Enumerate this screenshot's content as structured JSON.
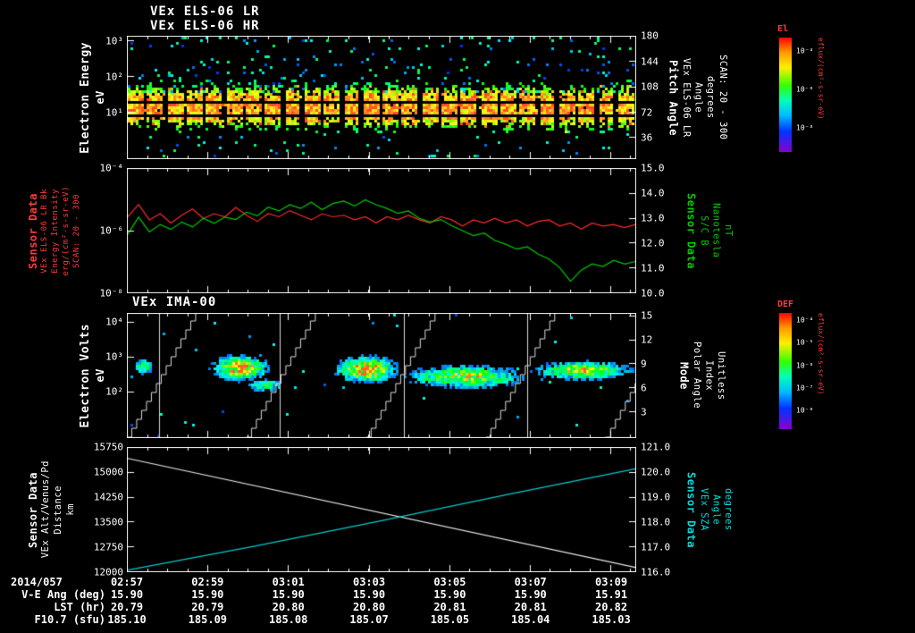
{
  "colors": {
    "background": "#000000",
    "text": "#ffffff",
    "frame": "#ffffff",
    "red_label": "#ff3b3b",
    "green_label": "#00cc00",
    "cyan_label": "#00dddd"
  },
  "panels": {
    "els": {
      "titles": [
        "VEx ELS-06 LR",
        "VEx ELS-06 HR"
      ],
      "left_label": [
        "Electron Energy",
        "eV"
      ],
      "left_ticks": [
        {
          "label": "10³",
          "frac": 0.04
        },
        {
          "label": "10²",
          "frac": 0.33
        },
        {
          "label": "10¹",
          "frac": 0.62
        }
      ],
      "right_ticks": [
        {
          "label": "180",
          "frac": 0.0
        },
        {
          "label": "144",
          "frac": 0.207
        },
        {
          "label": "108",
          "frac": 0.414
        },
        {
          "label": "72",
          "frac": 0.621
        },
        {
          "label": "36",
          "frac": 0.828
        }
      ],
      "right_label": [
        "Pitch Angle",
        "VEx ELS-06 LR",
        "Angle",
        "degrees",
        "SCAN: 20 - 300"
      ],
      "colorbar": {
        "title": "El",
        "unit": "eflux/(cm²-s-sr-eV)",
        "ticks": [
          {
            "label": "10⁻⁴",
            "frac": 0.12
          },
          {
            "label": "10⁻⁶",
            "frac": 0.45
          },
          {
            "label": "10⁻⁸",
            "frac": 0.79
          }
        ]
      }
    },
    "intensity": {
      "left_label": [
        "Sensor Data",
        "VEx ELS-06 LR Bk",
        "Energy Intensity",
        "erg/(cm²-s-sr-eV)",
        "SCAN: 20 - 300"
      ],
      "left_ticks": [
        {
          "label": "10⁻⁴",
          "frac": 0.0
        },
        {
          "label": "10⁻⁶",
          "frac": 0.5
        },
        {
          "label": "10⁻⁸",
          "frac": 1.0
        }
      ],
      "right_ticks": [
        {
          "label": "15.0",
          "frac": 0.0
        },
        {
          "label": "14.0",
          "frac": 0.2
        },
        {
          "label": "13.0",
          "frac": 0.4
        },
        {
          "label": "12.0",
          "frac": 0.6
        },
        {
          "label": "11.0",
          "frac": 0.8
        },
        {
          "label": "10.0",
          "frac": 1.0
        }
      ],
      "right_label": [
        "Sensor Data",
        "S/C B",
        "Nanotesla",
        "nT"
      ]
    },
    "ima": {
      "title": "VEx IMA-00",
      "left_label": [
        "Electron Volts",
        "eV"
      ],
      "left_ticks": [
        {
          "label": "10⁴",
          "frac": 0.07
        },
        {
          "label": "10³",
          "frac": 0.35
        },
        {
          "label": "10²",
          "frac": 0.63
        }
      ],
      "right_ticks": [
        {
          "label": "15",
          "frac": 0.02
        },
        {
          "label": "12",
          "frac": 0.2125
        },
        {
          "label": "9",
          "frac": 0.405
        },
        {
          "label": "6",
          "frac": 0.5975
        },
        {
          "label": "3",
          "frac": 0.79
        }
      ],
      "right_label": [
        "Mode",
        "Polar Angle",
        "Index",
        "Unitless"
      ],
      "colorbar": {
        "title": "DEF",
        "unit": "eflux/(cm²-s-sr-eV)",
        "ticks": [
          {
            "label": "10⁻⁴",
            "frac": 0.06
          },
          {
            "label": "10⁻⁵",
            "frac": 0.255
          },
          {
            "label": "10⁻⁶",
            "frac": 0.45
          },
          {
            "label": "10⁻⁷",
            "frac": 0.645
          },
          {
            "label": "10⁻⁸",
            "frac": 0.84
          }
        ]
      }
    },
    "altitude": {
      "left_label": [
        "Sensor Data",
        "VEx Alt/Venus/Pd",
        "Distance",
        "km"
      ],
      "left_ticks": [
        {
          "label": "15750",
          "frac": 0.0
        },
        {
          "label": "15000",
          "frac": 0.2
        },
        {
          "label": "14250",
          "frac": 0.4
        },
        {
          "label": "13500",
          "frac": 0.6
        },
        {
          "label": "12750",
          "frac": 0.8
        },
        {
          "label": "12000",
          "frac": 1.0
        }
      ],
      "right_ticks": [
        {
          "label": "121.0",
          "frac": 0.0
        },
        {
          "label": "120.0",
          "frac": 0.2
        },
        {
          "label": "119.0",
          "frac": 0.4
        },
        {
          "label": "118.0",
          "frac": 0.6
        },
        {
          "label": "117.0",
          "frac": 0.8
        },
        {
          "label": "116.0",
          "frac": 1.0
        }
      ],
      "right_label": [
        "Sensor Data",
        "VEx SZA",
        "Angle",
        "degrees"
      ]
    }
  },
  "bottom": {
    "date_label": "2014/057",
    "time_ticks": [
      "02:57",
      "02:59",
      "03:01",
      "03:03",
      "03:05",
      "03:07",
      "03:09"
    ],
    "rows": [
      {
        "label": "V-E Ang (deg)",
        "values": [
          "15.90",
          "15.90",
          "15.90",
          "15.90",
          "15.90",
          "15.90",
          "15.91"
        ]
      },
      {
        "label": "LST (hr)",
        "values": [
          "20.79",
          "20.79",
          "20.80",
          "20.80",
          "20.81",
          "20.81",
          "20.82"
        ]
      },
      {
        "label": "F10.7 (sfu)",
        "values": [
          "185.10",
          "185.09",
          "185.08",
          "185.07",
          "185.05",
          "185.04",
          "185.03"
        ]
      }
    ]
  },
  "chart_data": [
    {
      "type": "heatmap",
      "title": "VEx ELS-06 LR/HR electron energy-time spectrogram",
      "x_tick_labels": [
        "02:57",
        "02:59",
        "03:01",
        "03:03",
        "03:05",
        "03:07",
        "03:09"
      ],
      "ylabel": "Electron Energy (eV)",
      "y_scale": "log",
      "y_tick_labels": [
        "10³",
        "10²",
        "10¹"
      ],
      "y2label": "Pitch Angle (degrees), SCAN: 20 - 300",
      "y2_tick_labels": [
        "180",
        "144",
        "108",
        "72",
        "36"
      ],
      "zlabel": "El eflux/(cm²-s-sr-eV)",
      "z_ticks": [
        "10⁻⁴",
        "10⁻⁶",
        "10⁻⁸"
      ],
      "description": "Continuous green-yellow band of high electron flux between ~5 and ~100 eV arranged in ~26 regular scan-time blocks, with sparse cyan/blue speckles at higher energies up to 10^3 eV",
      "pattern": {
        "band_center_frac": 0.57,
        "band_halfwidth_frac": 0.16,
        "n_blocks": 26,
        "speckle_density": 0.09,
        "dark_rows": [
          0.52,
          0.635
        ],
        "seed": 7
      }
    },
    {
      "type": "line",
      "x": "48 samples evenly spaced over 02:57 - 03:10",
      "series": [
        {
          "name": "VEx ELS-06 LR Bk Energy Intensity",
          "color": "#ff2a2a",
          "units": "log10 erg/(cm²-s-sr-eV)",
          "y_top": -4,
          "y_bottom": -8,
          "values": [
            -5.55,
            -5.15,
            -5.65,
            -5.45,
            -5.75,
            -5.5,
            -5.3,
            -5.6,
            -5.45,
            -5.55,
            -5.25,
            -5.5,
            -5.7,
            -5.45,
            -5.55,
            -5.35,
            -5.5,
            -5.65,
            -5.45,
            -5.55,
            -5.5,
            -5.65,
            -5.55,
            -5.75,
            -5.55,
            -5.65,
            -5.5,
            -5.65,
            -5.75,
            -5.55,
            -5.65,
            -5.85,
            -5.65,
            -5.75,
            -5.6,
            -5.75,
            -5.65,
            -5.85,
            -5.7,
            -5.65,
            -5.85,
            -5.75,
            -5.95,
            -5.75,
            -5.85,
            -5.8,
            -5.9,
            -5.8
          ]
        },
        {
          "name": "S/C B",
          "color": "#00cc00",
          "units": "nT",
          "y_top": 15,
          "y_bottom": 10,
          "values": [
            12.35,
            13.05,
            12.45,
            12.75,
            12.55,
            12.85,
            12.65,
            13.0,
            12.8,
            13.05,
            12.95,
            13.25,
            13.1,
            13.45,
            13.3,
            13.55,
            13.4,
            13.65,
            13.35,
            13.6,
            13.7,
            13.5,
            13.75,
            13.55,
            13.4,
            13.2,
            13.3,
            13.0,
            12.85,
            12.95,
            12.7,
            12.5,
            12.3,
            12.4,
            12.1,
            11.95,
            11.75,
            11.85,
            11.55,
            11.35,
            11.0,
            10.45,
            10.9,
            11.15,
            11.05,
            11.3,
            11.15,
            11.25
          ]
        }
      ]
    },
    {
      "type": "heatmap",
      "title": "VEx IMA-00 ion energy-time spectrogram",
      "ylabel": "Electron Volts (eV)",
      "y_scale": "log",
      "y_tick_labels": [
        "10⁴",
        "10³",
        "10²"
      ],
      "y2label": "Mode / Polar Angle Index (Unitless)",
      "y2_tick_labels": [
        "15",
        "12",
        "9",
        "6",
        "3"
      ],
      "zlabel": "DEF eflux/(cm²-s-sr-eV)",
      "z_ticks": [
        "10⁻⁴",
        "10⁻⁵",
        "10⁻⁶",
        "10⁻⁷",
        "10⁻⁸"
      ],
      "description": "Ion flux bursts near a few hundred eV; white staircase traces show the repeating elevation-scan pattern; vertical white lines mark scan boundaries",
      "blobs": [
        {
          "x0": 0.01,
          "x1": 0.05,
          "yc": 0.42,
          "ry": 0.05,
          "amp": 0.55
        },
        {
          "x0": 0.165,
          "x1": 0.275,
          "yc": 0.43,
          "ry": 0.08,
          "amp": 0.92
        },
        {
          "x0": 0.23,
          "x1": 0.31,
          "yc": 0.57,
          "ry": 0.045,
          "amp": 0.45
        },
        {
          "x0": 0.41,
          "x1": 0.525,
          "yc": 0.44,
          "ry": 0.085,
          "amp": 1.0
        },
        {
          "x0": 0.545,
          "x1": 0.78,
          "yc": 0.5,
          "ry": 0.075,
          "amp": 0.72
        },
        {
          "x0": 0.8,
          "x1": 0.99,
          "yc": 0.45,
          "ry": 0.06,
          "amp": 0.78
        }
      ],
      "staircase": {
        "bottoms": [
          0.0,
          0.235,
          0.47,
          0.705,
          0.94
        ],
        "rise_frac": 0.135,
        "steps": 14
      },
      "vlines": [
        0.063,
        0.3,
        0.544,
        0.786
      ],
      "seed": 11
    },
    {
      "type": "line",
      "series": [
        {
          "name": "VEx Alt/Venus/Pd Distance",
          "color": "#e8e8e8",
          "units": "km",
          "y_top": 15750,
          "y_bottom": 12000,
          "points": [
            [
              0,
              15430
            ],
            [
              1,
              12120
            ]
          ]
        },
        {
          "name": "VEx SZA",
          "color": "#00cccc",
          "units": "degrees",
          "y_top": 121,
          "y_bottom": 116,
          "points": [
            [
              0,
              116.05
            ],
            [
              0.25,
              117.02
            ],
            [
              0.5,
              118.05
            ],
            [
              0.75,
              119.12
            ],
            [
              1,
              120.15
            ]
          ]
        }
      ]
    }
  ]
}
